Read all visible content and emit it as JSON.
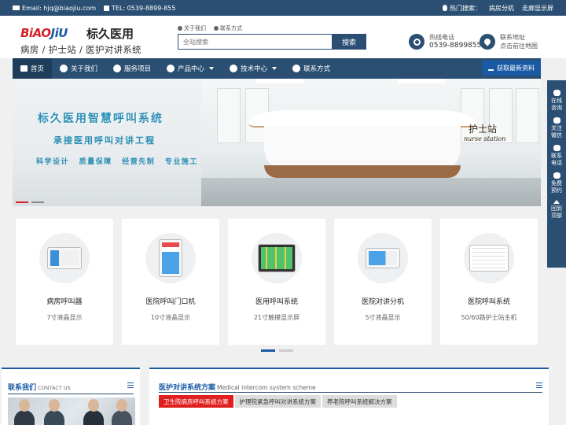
{
  "topbar": {
    "email": "Email: hjq@biaojiu.com",
    "tel": "TEL: 0539-8899-855",
    "hot_label": "热门搜索：",
    "hot_links": [
      "病房分机",
      "走廊显示屏"
    ]
  },
  "header": {
    "logo_en": "BiAOJiU",
    "logo_cn": "标久医用",
    "logo_sub": "病房 / 护士站 / 医护对讲系统",
    "quicklinks": [
      "关于我们",
      "联系方式"
    ],
    "search_placeholder": "全站搜索",
    "search_button": "搜索",
    "hotline_label": "热线电话",
    "hotline_number": "0539-8899855",
    "address_label": "联系地址",
    "address_link": "点击前往地图"
  },
  "nav": {
    "items": [
      {
        "label": "首页",
        "active": true
      },
      {
        "label": "关于我们",
        "active": false
      },
      {
        "label": "服务项目",
        "active": false
      },
      {
        "label": "产品中心",
        "active": false,
        "dropdown": true
      },
      {
        "label": "技术中心",
        "active": false,
        "dropdown": true
      },
      {
        "label": "联系方式",
        "active": false
      }
    ],
    "download_button": "获取最新资料"
  },
  "banner": {
    "title": "标久医用智慧呼叫系统",
    "subtitle": "承接医用呼叫对讲工程",
    "tags": "科学设计 质量保障 经营先制 专业施工",
    "sign_cn": "护士站",
    "sign_en": "nurse station"
  },
  "products": [
    {
      "name": "病房呼叫器",
      "desc": "7寸液晶显示",
      "icon": "wall-terminal-icon"
    },
    {
      "name": "医院呼叫门口机",
      "desc": "10寸液晶显示",
      "icon": "door-terminal-icon"
    },
    {
      "name": "医用呼叫系统",
      "desc": "21寸触摸显示屏",
      "icon": "touch-screen-icon"
    },
    {
      "name": "医院对讲分机",
      "desc": "5寸液晶显示",
      "icon": "intercom-extension-icon"
    },
    {
      "name": "医院呼叫系统",
      "desc": "50/60路护士站主机",
      "icon": "nurse-station-host-icon"
    }
  ],
  "contact_box": {
    "title": "联系我们",
    "title_en": "CONTACT US"
  },
  "solutions_box": {
    "title": "医护对讲系统方案",
    "title_en": "Medical intercom system scheme",
    "tabs": [
      {
        "label": "卫生院病房呼叫系统方案",
        "active": true
      },
      {
        "label": "护理院紧急呼叫对讲系统方案",
        "active": false
      },
      {
        "label": "养老院呼叫系统解决方案",
        "active": false
      }
    ]
  },
  "float_bar": [
    {
      "label": "在线\n咨询",
      "icon": "chat-icon"
    },
    {
      "label": "关注\n微信",
      "icon": "wechat-icon"
    },
    {
      "label": "联系\n电话",
      "icon": "phone-icon"
    },
    {
      "label": "免费\n预约",
      "icon": "edit-icon"
    },
    {
      "label": "回到\n顶部",
      "icon": "chevron-up-icon"
    }
  ],
  "colors": {
    "primary": "#2a4f73",
    "accent_blue": "#1a5aa5",
    "accent_red": "#e02020",
    "banner_text": "#2b8fb5"
  }
}
